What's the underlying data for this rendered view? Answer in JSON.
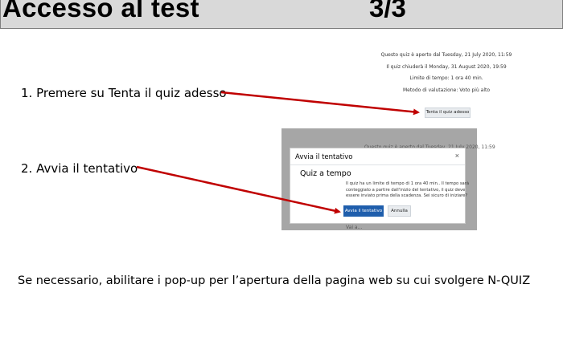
{
  "header": {
    "title": "Accesso al test",
    "page": "3/3"
  },
  "steps": {
    "step1": "1. Premere su Tenta il quiz adesso",
    "step2": "2. Avvia il tentativo"
  },
  "quiz_info": {
    "line1": "Questo quiz è aperto dal Tuesday, 21 July 2020, 11:59",
    "line2": "Il quiz chiuderà il Monday, 31 August 2020, 19:59",
    "line3": "Limite di tempo: 1 ora 40 min.",
    "line4": "Metodo di valutazione: Voto più alto",
    "try_button": "Tenta il quiz adesso"
  },
  "background": {
    "info_line": "Questo quiz è aperto dal Tuesday, 21 July 2020, 11:59",
    "link_text": "Vai a..."
  },
  "modal": {
    "title": "Avvia il tentativo",
    "close": "×",
    "subtitle": "Quiz a tempo",
    "body_line1": "Il quiz ha un limite di tempo di 1 ora 40 min.. Il tempo sarà",
    "body_line2": "conteggiato a partire dall'inizio del tentativo, il quiz deve",
    "body_line3": "essere inviato prima della scadenza. Sei sicuro di iniziare?",
    "start_button": "Avvia il tentativo",
    "cancel_button": "Annulla"
  },
  "note": "Se necessario, abilitare i pop-up per l’apertura della pagina web su cui svolgere N-QUIZ",
  "colors": {
    "arrow": "#c00000",
    "primary_button": "#1f5eac",
    "header_bg": "#d9d9d9"
  }
}
